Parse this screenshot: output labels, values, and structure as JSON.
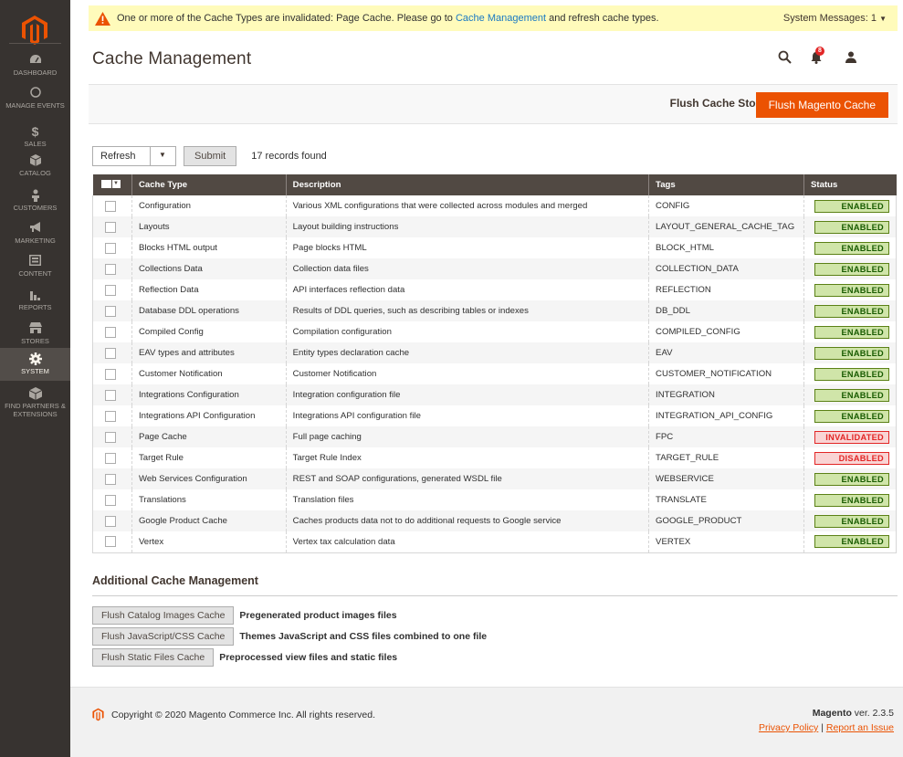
{
  "colors": {
    "accent": "#eb5202",
    "sidebar": "#373330",
    "header_row": "#514943",
    "enabled": "#185b00",
    "invalid": "#e22626"
  },
  "sidebar": {
    "items": [
      {
        "label": "DASHBOARD",
        "icon": "dashboard-icon"
      },
      {
        "label": "MANAGE EVENTS",
        "icon": "circle-icon"
      },
      {
        "label": "SALES",
        "icon": "dollar-icon"
      },
      {
        "label": "CATALOG",
        "icon": "cube-icon"
      },
      {
        "label": "CUSTOMERS",
        "icon": "person-icon"
      },
      {
        "label": "MARKETING",
        "icon": "megaphone-icon"
      },
      {
        "label": "CONTENT",
        "icon": "layout-icon"
      },
      {
        "label": "REPORTS",
        "icon": "bar-chart-icon"
      },
      {
        "label": "STORES",
        "icon": "store-icon"
      },
      {
        "label": "SYSTEM",
        "icon": "gear-icon"
      },
      {
        "label": "FIND PARTNERS & EXTENSIONS",
        "icon": "cubes-icon"
      }
    ]
  },
  "system_message": {
    "text_before": "One or more of the Cache Types are invalidated: Page Cache. Please go to ",
    "link": "Cache Management",
    "text_after": " and refresh cache types.",
    "count": "System Messages: 1"
  },
  "page": {
    "title": "Cache Management",
    "notifications": "8"
  },
  "actions": {
    "flush_storage": "Flush Cache Storage",
    "flush_magento": "Flush Magento Cache"
  },
  "massaction": {
    "selected": "Refresh",
    "submit": "Submit",
    "records": "17 records found"
  },
  "table": {
    "headers": {
      "type": "Cache Type",
      "description": "Description",
      "tags": "Tags",
      "status": "Status"
    },
    "rows": [
      {
        "type": "Configuration",
        "description": "Various XML configurations that were collected across modules and merged",
        "tags": "CONFIG",
        "status": "ENABLED"
      },
      {
        "type": "Layouts",
        "description": "Layout building instructions",
        "tags": "LAYOUT_GENERAL_CACHE_TAG",
        "status": "ENABLED"
      },
      {
        "type": "Blocks HTML output",
        "description": "Page blocks HTML",
        "tags": "BLOCK_HTML",
        "status": "ENABLED"
      },
      {
        "type": "Collections Data",
        "description": "Collection data files",
        "tags": "COLLECTION_DATA",
        "status": "ENABLED"
      },
      {
        "type": "Reflection Data",
        "description": "API interfaces reflection data",
        "tags": "REFLECTION",
        "status": "ENABLED"
      },
      {
        "type": "Database DDL operations",
        "description": "Results of DDL queries, such as describing tables or indexes",
        "tags": "DB_DDL",
        "status": "ENABLED"
      },
      {
        "type": "Compiled Config",
        "description": "Compilation configuration",
        "tags": "COMPILED_CONFIG",
        "status": "ENABLED"
      },
      {
        "type": "EAV types and attributes",
        "description": "Entity types declaration cache",
        "tags": "EAV",
        "status": "ENABLED"
      },
      {
        "type": "Customer Notification",
        "description": "Customer Notification",
        "tags": "CUSTOMER_NOTIFICATION",
        "status": "ENABLED"
      },
      {
        "type": "Integrations Configuration",
        "description": "Integration configuration file",
        "tags": "INTEGRATION",
        "status": "ENABLED"
      },
      {
        "type": "Integrations API Configuration",
        "description": "Integrations API configuration file",
        "tags": "INTEGRATION_API_CONFIG",
        "status": "ENABLED"
      },
      {
        "type": "Page Cache",
        "description": "Full page caching",
        "tags": "FPC",
        "status": "INVALIDATED"
      },
      {
        "type": "Target Rule",
        "description": "Target Rule Index",
        "tags": "TARGET_RULE",
        "status": "DISABLED"
      },
      {
        "type": "Web Services Configuration",
        "description": "REST and SOAP configurations, generated WSDL file",
        "tags": "WEBSERVICE",
        "status": "ENABLED"
      },
      {
        "type": "Translations",
        "description": "Translation files",
        "tags": "TRANSLATE",
        "status": "ENABLED"
      },
      {
        "type": "Google Product Cache",
        "description": "Caches products data not to do additional requests to Google service",
        "tags": "GOOGLE_PRODUCT",
        "status": "ENABLED"
      },
      {
        "type": "Vertex",
        "description": "Vertex tax calculation data",
        "tags": "VERTEX",
        "status": "ENABLED"
      }
    ]
  },
  "additional": {
    "title": "Additional Cache Management",
    "items": [
      {
        "button": "Flush Catalog Images Cache",
        "desc": "Pregenerated product images files"
      },
      {
        "button": "Flush JavaScript/CSS Cache",
        "desc": "Themes JavaScript and CSS files combined to one file"
      },
      {
        "button": "Flush Static Files Cache",
        "desc": "Preprocessed view files and static files"
      }
    ]
  },
  "footer": {
    "copyright": "Copyright © 2020 Magento Commerce Inc. All rights reserved.",
    "brand": "Magento",
    "version": " ver. 2.3.5",
    "privacy": "Privacy Policy",
    "separator": " | ",
    "report": "Report an Issue"
  }
}
